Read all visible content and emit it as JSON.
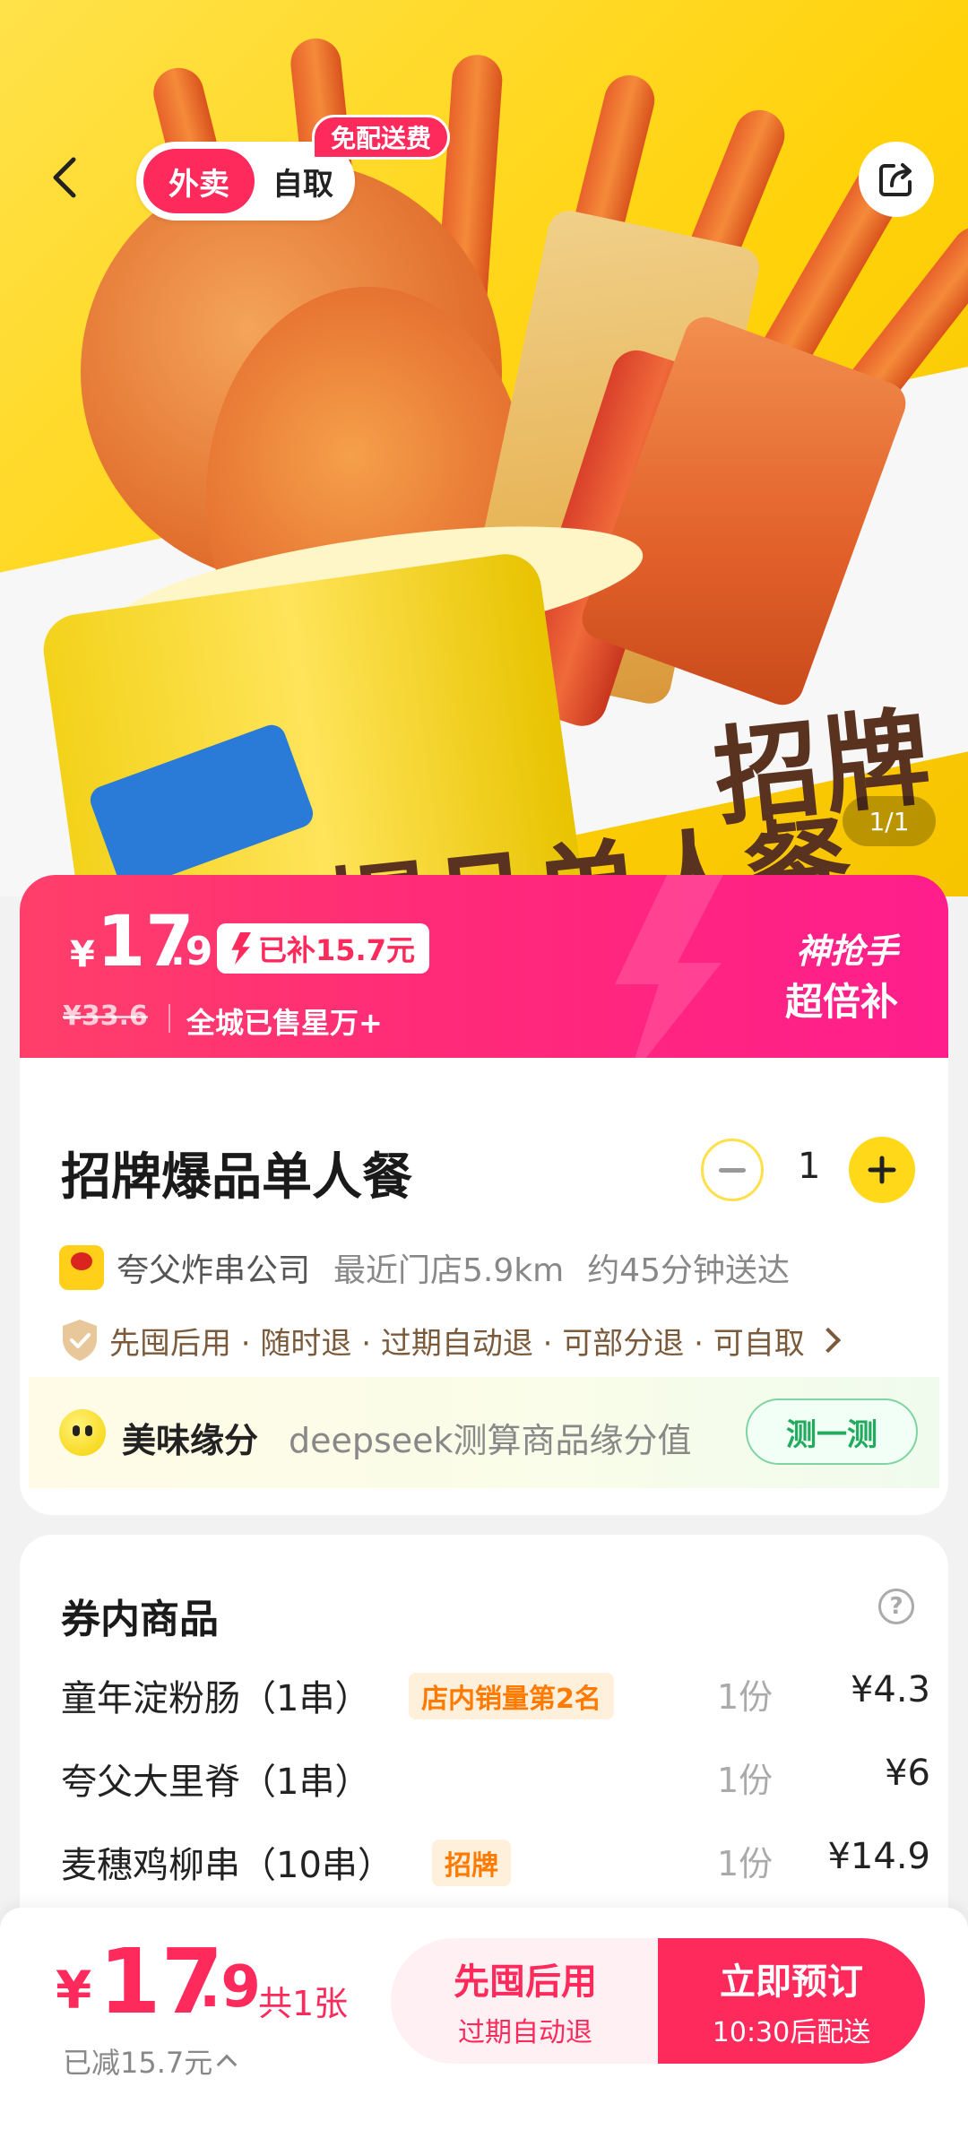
{
  "top_bar": {
    "mode_active": "外卖",
    "mode_other": "自取",
    "free_delivery_tag": "免配送费",
    "page_indicator": "1/1"
  },
  "hero": {
    "headline_line1": "招牌",
    "headline_line2": "爆品单人餐"
  },
  "price_banner": {
    "currency": "¥",
    "price_int": "17",
    "price_dec": ".9",
    "subsidy_label": "已补15.7元",
    "original_price": "¥33.6",
    "sales_text": "全城已售星万+",
    "promo_line1": "神抢手",
    "promo_line2": "超倍补"
  },
  "product": {
    "title": "招牌爆品单人餐",
    "quantity": "1",
    "shop_name": "夸父炸串公司",
    "nearest_store": "最近门店5.9km",
    "eta": "约45分钟送达",
    "promises": "先囤后用 · 随时退 · 过期自动退 · 可部分退 · 可自取",
    "match_title": "美味缘分",
    "match_desc": "deepseek测算商品缘分值",
    "match_button": "测一测"
  },
  "items": {
    "title": "券内商品",
    "help": "?",
    "rows": [
      {
        "name": "童年淀粉肠（1串）",
        "tag": "店内销量第2名",
        "qty": "1份",
        "price": "¥4.3"
      },
      {
        "name": "夸父大里脊（1串）",
        "tag": "",
        "qty": "1份",
        "price": "¥6"
      },
      {
        "name": "麦穗鸡柳串（10串）",
        "tag": "招牌",
        "qty": "1份",
        "price": "¥14.9"
      }
    ]
  },
  "bottom_bar": {
    "currency": "¥",
    "price_int": "17",
    "price_dec": ".9",
    "count": "共1张",
    "saved": "已减15.7元",
    "btn_left_title": "先囤后用",
    "btn_left_sub": "过期自动退",
    "btn_right_title": "立即预订",
    "btn_right_sub": "10:30后配送"
  },
  "colors": {
    "accent": "#ff2a5c",
    "banner_gradient_end": "#ff1e8c",
    "hero_yellow": "#ffd20a",
    "plus_button": "#ffd81a",
    "match_green": "#22aa5e"
  }
}
